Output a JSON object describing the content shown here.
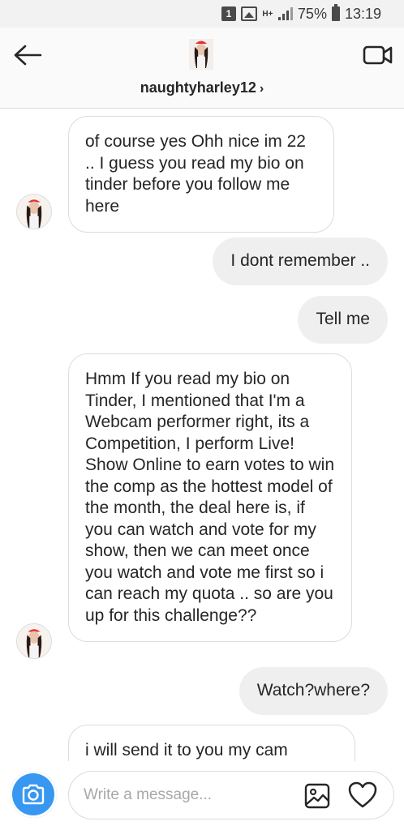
{
  "status_bar": {
    "sim_slot": "1",
    "network": "H+",
    "battery": "75%",
    "time": "13:19"
  },
  "header": {
    "username": "naughtyharley12",
    "chevron": "›",
    "back_icon": "arrow-left-icon",
    "video_icon": "video-camera-icon"
  },
  "messages": [
    {
      "direction": "incoming",
      "text": "of course yes Ohh nice im 22 .. I guess you read my bio on tinder before you follow me here"
    },
    {
      "direction": "outgoing",
      "text": "I dont remember .."
    },
    {
      "direction": "outgoing",
      "text": "Tell me"
    },
    {
      "direction": "incoming",
      "text": "Hmm If you read my bio on Tinder, I mentioned that I'm a Webcam performer right, its a Competition, I perform Live! Show Online to earn votes to win the comp as the hottest model of the month, the deal here is, if you can watch and vote for my show, then we can meet once you watch and vote me first so i can reach my quota .. so are you up for this challenge??"
    },
    {
      "direction": "outgoing",
      "text": "Watch?where?"
    },
    {
      "direction": "incoming",
      "text": "i will send it to you my cam"
    }
  ],
  "composer": {
    "placeholder": "Write a message...",
    "camera_icon": "camera-icon",
    "gallery_icon": "gallery-icon",
    "heart_icon": "heart-icon"
  },
  "colors": {
    "accent": "#3897f0",
    "outgoing_bubble": "#efefef",
    "incoming_border": "#dcdcdc",
    "text": "#262626"
  }
}
